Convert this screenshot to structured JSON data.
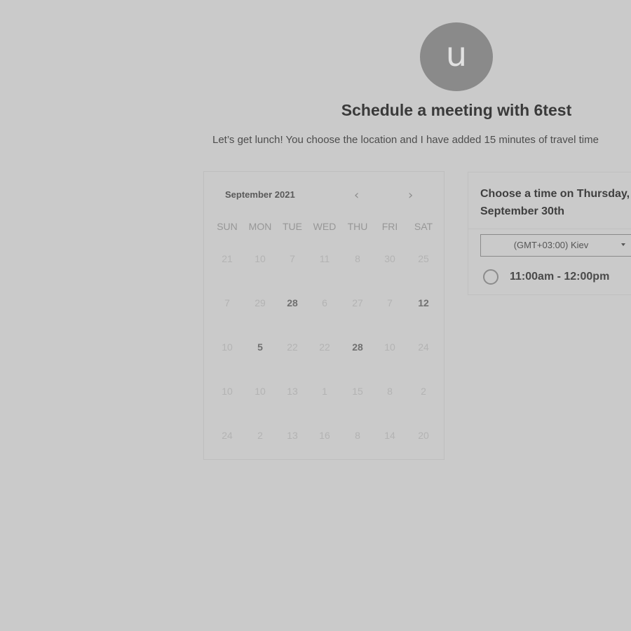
{
  "header": {
    "avatar_letter": "u",
    "title": "Schedule a meeting with 6test",
    "subtitle": "Let’s get lunch! You choose the location and I have added 15 minutes of travel time"
  },
  "calendar": {
    "month_label": "September 2021",
    "prev_icon": "chevron-left-icon",
    "next_icon": "chevron-right-icon",
    "weekdays": [
      "SUN",
      "MON",
      "TUE",
      "WED",
      "THU",
      "FRI",
      "SAT"
    ],
    "weeks": [
      [
        {
          "d": "21",
          "a": false
        },
        {
          "d": "10",
          "a": false
        },
        {
          "d": "7",
          "a": false
        },
        {
          "d": "11",
          "a": false
        },
        {
          "d": "8",
          "a": false
        },
        {
          "d": "30",
          "a": false
        },
        {
          "d": "25",
          "a": false
        }
      ],
      [
        {
          "d": "7",
          "a": false
        },
        {
          "d": "29",
          "a": false
        },
        {
          "d": "28",
          "a": true
        },
        {
          "d": "6",
          "a": false
        },
        {
          "d": "27",
          "a": false
        },
        {
          "d": "7",
          "a": false
        },
        {
          "d": "12",
          "a": true
        }
      ],
      [
        {
          "d": "10",
          "a": false
        },
        {
          "d": "5",
          "a": true
        },
        {
          "d": "22",
          "a": false
        },
        {
          "d": "22",
          "a": false
        },
        {
          "d": "28",
          "a": true
        },
        {
          "d": "10",
          "a": false
        },
        {
          "d": "24",
          "a": false
        }
      ],
      [
        {
          "d": "10",
          "a": false
        },
        {
          "d": "10",
          "a": false
        },
        {
          "d": "13",
          "a": false
        },
        {
          "d": "1",
          "a": false
        },
        {
          "d": "15",
          "a": false
        },
        {
          "d": "8",
          "a": false
        },
        {
          "d": "2",
          "a": false
        }
      ],
      [
        {
          "d": "24",
          "a": false
        },
        {
          "d": "2",
          "a": false
        },
        {
          "d": "13",
          "a": false
        },
        {
          "d": "16",
          "a": false
        },
        {
          "d": "8",
          "a": false
        },
        {
          "d": "14",
          "a": false
        },
        {
          "d": "20",
          "a": false
        }
      ]
    ]
  },
  "times": {
    "title": "Choose a time on Thursday, September 30th",
    "timezone": "(GMT+03:00) Kiev",
    "slots": [
      {
        "label": "11:00am - 12:00pm"
      }
    ]
  },
  "colors": {
    "background": "#cacaca",
    "avatar": "#8a8a8a"
  }
}
